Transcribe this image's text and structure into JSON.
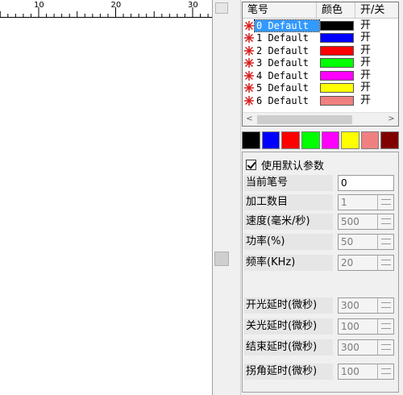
{
  "ruler": {
    "labels": [
      "10",
      "20",
      "30"
    ]
  },
  "pen_list": {
    "columns": [
      "笔号",
      "颜色",
      "开/关"
    ],
    "rows": [
      {
        "name": "0 Default",
        "color": "#000000",
        "on": "开",
        "selected": true
      },
      {
        "name": "1 Default",
        "color": "#0000ff",
        "on": "开",
        "selected": false
      },
      {
        "name": "2 Default",
        "color": "#ff0000",
        "on": "开",
        "selected": false
      },
      {
        "name": "3 Default",
        "color": "#00ff00",
        "on": "开",
        "selected": false
      },
      {
        "name": "4 Default",
        "color": "#ff00ff",
        "on": "开",
        "selected": false
      },
      {
        "name": "5 Default",
        "color": "#ffff00",
        "on": "开",
        "selected": false
      },
      {
        "name": "6 Default",
        "color": "#f08080",
        "on": "开",
        "selected": false
      }
    ],
    "scroll_left": "<",
    "scroll_right": ">"
  },
  "palette": [
    "#000000",
    "#0000ff",
    "#ff0000",
    "#00ff00",
    "#ff00ff",
    "#ffff00",
    "#f08080",
    "#800000"
  ],
  "params": {
    "use_default_label": "使用默认参数",
    "use_default_checked": true,
    "fields": [
      {
        "label": "当前笔号",
        "value": "0",
        "spin": false
      },
      {
        "label": "加工数目",
        "value": "1",
        "spin": true
      },
      {
        "label": "速度(毫米/秒)",
        "value": "500",
        "spin": true
      },
      {
        "label": "功率(%)",
        "value": "50",
        "spin": true
      },
      {
        "label": "频率(KHz)",
        "value": "20",
        "spin": true
      },
      {
        "label": "开光延时(微秒)",
        "value": "300",
        "spin": true
      },
      {
        "label": "关光延时(微秒)",
        "value": "100",
        "spin": true
      },
      {
        "label": "结束延时(微秒)",
        "value": "300",
        "spin": true
      },
      {
        "label": "拐角延时(微秒)",
        "value": "100",
        "spin": true
      }
    ]
  }
}
